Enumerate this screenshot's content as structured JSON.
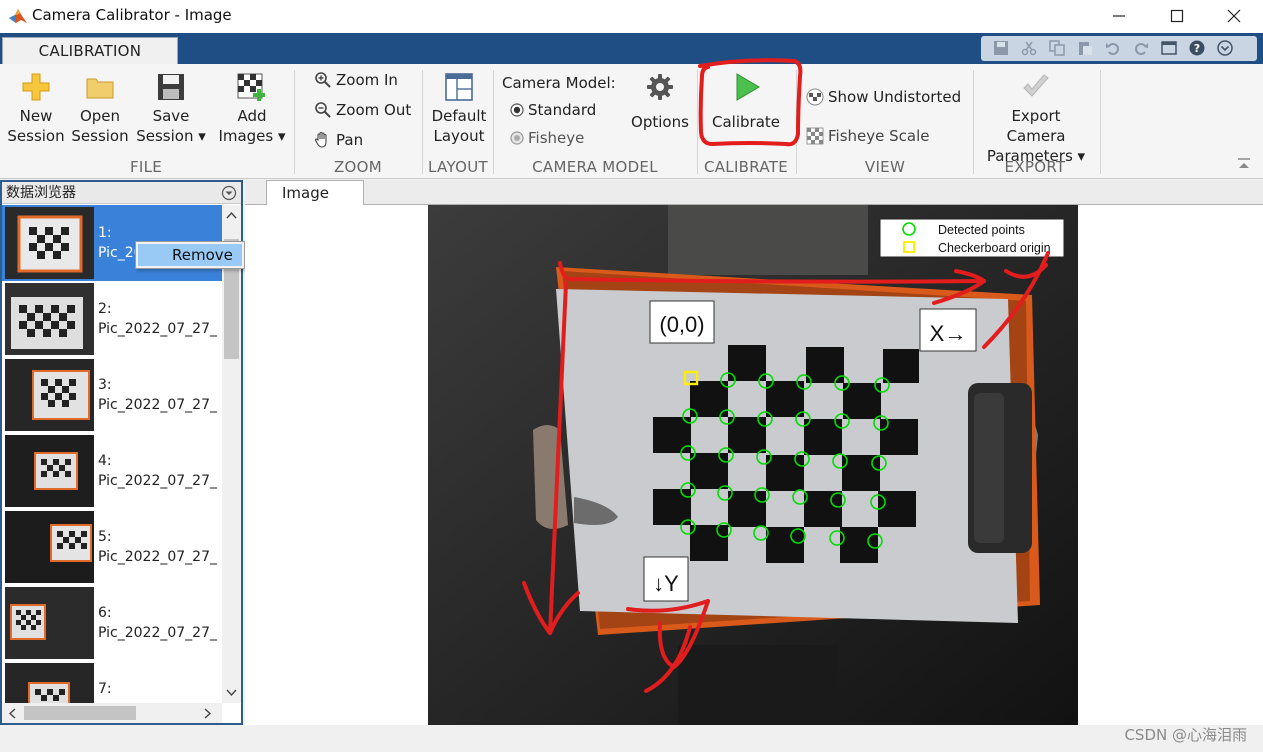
{
  "window": {
    "title": "Camera Calibrator - Image"
  },
  "ribbon": {
    "tab_label": "CALIBRATION",
    "file": {
      "new_session": [
        "New",
        "Session"
      ],
      "open_session": [
        "Open",
        "Session"
      ],
      "save_session": [
        "Save",
        "Session"
      ],
      "add_images": [
        "Add",
        "Images"
      ],
      "group_label": "FILE"
    },
    "zoom": {
      "zoom_in": "Zoom In",
      "zoom_out": "Zoom Out",
      "pan": "Pan",
      "group_label": "ZOOM"
    },
    "layout": {
      "default_layout": [
        "Default",
        "Layout"
      ],
      "group_label": "LAYOUT"
    },
    "camera_model": {
      "heading": "Camera Model:",
      "standard": "Standard",
      "fisheye": "Fisheye",
      "options": "Options",
      "group_label": "CAMERA MODEL"
    },
    "calibrate": {
      "button": "Calibrate",
      "group_label": "CALIBRATE"
    },
    "view": {
      "show_undistorted": "Show Undistorted",
      "fisheye_scale": "Fisheye Scale",
      "group_label": "VIEW"
    },
    "export": {
      "export_params": [
        "Export Camera",
        "Parameters"
      ],
      "group_label": "EXPORT"
    }
  },
  "browser": {
    "title": "数据浏览器",
    "items": [
      {
        "num": "1:",
        "name": "Pic_2022_07_27_"
      },
      {
        "num": "2:",
        "name": "Pic_2022_07_27_"
      },
      {
        "num": "3:",
        "name": "Pic_2022_07_27_"
      },
      {
        "num": "4:",
        "name": "Pic_2022_07_27_"
      },
      {
        "num": "5:",
        "name": "Pic_2022_07_27_"
      },
      {
        "num": "6:",
        "name": "Pic_2022_07_27_"
      },
      {
        "num": "7:",
        "name": ""
      }
    ],
    "selected_index": 0,
    "context_menu": {
      "remove": "Remove"
    }
  },
  "document": {
    "tab_label": "Image",
    "legend": {
      "detected": "Detected points",
      "origin": "Checkerboard origin"
    },
    "annotations": {
      "origin": "(0,0)",
      "x_axis": "X→",
      "y_axis": "↓Y"
    },
    "colors": {
      "detected": "#00dd00",
      "origin": "#ffee00",
      "annotation": "#e02020"
    }
  },
  "watermark": "CSDN @心海泪雨"
}
